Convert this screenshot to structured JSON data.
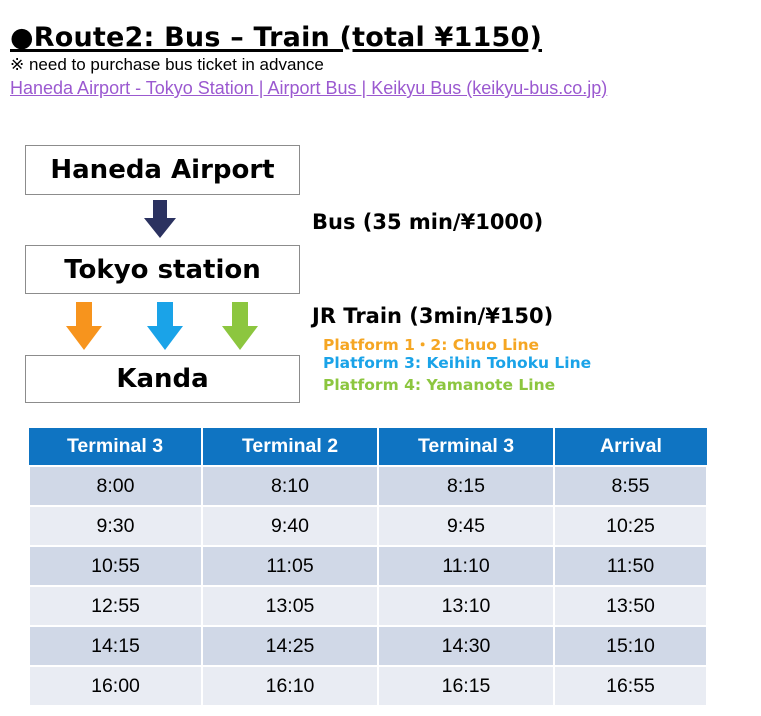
{
  "header": {
    "title": "●Route2: Bus – Train (total ¥1150)",
    "note": "※ need to purchase bus ticket in advance",
    "link_text": "Haneda Airport - Tokyo Station | Airport Bus | Keikyu Bus (keikyu-bus.co.jp)"
  },
  "diagram": {
    "start": "Haneda Airport",
    "middle": "Tokyo station",
    "end": "Kanda",
    "bus_label": "Bus (35 min/¥1000)",
    "train_label": "JR Train (3min/¥150)",
    "platforms": [
      {
        "text": "Platform 1・2: Chuo Line",
        "color": "#f5a623"
      },
      {
        "text": "Platform 3: Keihin Tohoku Line",
        "color": "#1aa3e8"
      },
      {
        "text": "Platform 4: Yamanote Line",
        "color": "#8cc63f"
      }
    ],
    "arrow_colors": {
      "bus": "#2b3260",
      "orange": "#f7941d",
      "blue": "#1aa3e8",
      "green": "#8cc63f"
    }
  },
  "timetable": {
    "header_color": "#0f74c2",
    "columns": [
      "Terminal 3",
      "Terminal 2",
      "Terminal 3",
      "Arrival"
    ],
    "rows": [
      [
        "8:00",
        "8:10",
        "8:15",
        "8:55"
      ],
      [
        "9:30",
        "9:40",
        "9:45",
        "10:25"
      ],
      [
        "10:55",
        "11:05",
        "11:10",
        "11:50"
      ],
      [
        "12:55",
        "13:05",
        "13:10",
        "13:50"
      ],
      [
        "14:15",
        "14:25",
        "14:30",
        "15:10"
      ],
      [
        "16:00",
        "16:10",
        "16:15",
        "16:55"
      ]
    ]
  }
}
